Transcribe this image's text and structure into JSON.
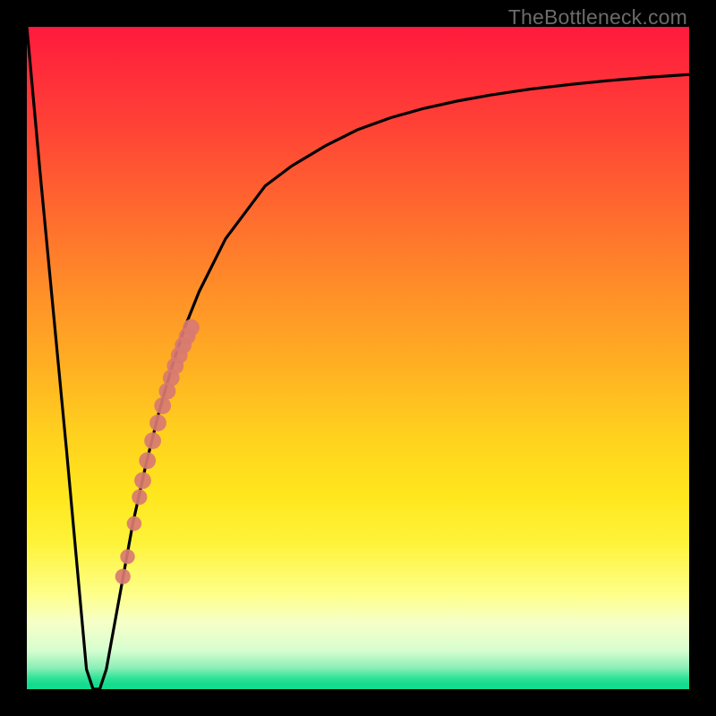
{
  "watermark": "TheBottleneck.com",
  "chart_data": {
    "type": "line",
    "title": "",
    "xlabel": "",
    "ylabel": "",
    "xlim": [
      0,
      100
    ],
    "ylim": [
      0,
      100
    ],
    "grid": false,
    "series": [
      {
        "name": "bottleneck-curve",
        "x": [
          0,
          2,
          4,
          6,
          8,
          9,
          10,
          11,
          12,
          14,
          16,
          18,
          20,
          22,
          24,
          26,
          28,
          30,
          33,
          36,
          40,
          45,
          50,
          55,
          60,
          65,
          70,
          76,
          82,
          88,
          94,
          100
        ],
        "y": [
          100,
          78,
          57,
          36,
          14,
          3,
          0,
          0,
          3,
          14,
          25,
          34,
          42,
          49,
          55,
          60,
          64,
          68,
          72,
          76,
          79,
          82,
          84.5,
          86.3,
          87.7,
          88.8,
          89.7,
          90.6,
          91.3,
          91.9,
          92.4,
          92.8
        ]
      },
      {
        "name": "highlight-dots",
        "x": [
          17.5,
          18.2,
          19.0,
          19.8,
          20.5,
          21.2,
          21.8,
          22.4,
          23.0,
          23.6,
          24.2,
          24.8,
          17.0,
          16.2,
          15.2,
          14.5
        ],
        "y": [
          31.5,
          34.5,
          37.5,
          40.2,
          42.8,
          45.0,
          47.0,
          48.8,
          50.4,
          51.9,
          53.3,
          54.6,
          29.0,
          25.0,
          20.0,
          17.0
        ]
      }
    ],
    "background_gradient": {
      "type": "vertical",
      "stops": [
        {
          "pos": 0.0,
          "color": "#ff1a3d"
        },
        {
          "pos": 0.15,
          "color": "#ff4236"
        },
        {
          "pos": 0.4,
          "color": "#ff8f28"
        },
        {
          "pos": 0.62,
          "color": "#ffd21e"
        },
        {
          "pos": 0.8,
          "color": "#fef33a"
        },
        {
          "pos": 0.9,
          "color": "#f6ffc8"
        },
        {
          "pos": 0.97,
          "color": "#8aefb6"
        },
        {
          "pos": 1.0,
          "color": "#14dc8e"
        }
      ]
    },
    "annotations": [
      {
        "text": "TheBottleneck.com",
        "position": "top-right",
        "color": "#6b6b6b"
      }
    ]
  }
}
